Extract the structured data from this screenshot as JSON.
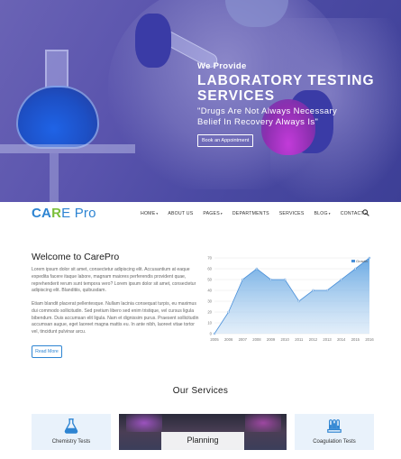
{
  "hero": {
    "subtitle": "We Provide",
    "title_line1": "LABORATORY TESTING",
    "title_line2": "SERVICES",
    "quote_line1": "\"Drugs Are Not Always Necessary",
    "quote_line2": "Belief In Recovery Always Is\"",
    "button_label": "Book an Appointment"
  },
  "nav": {
    "logo_part1": "CA",
    "logo_part2": "R",
    "logo_part3": "E Pro",
    "items": [
      {
        "label": "HOME",
        "has_caret": true
      },
      {
        "label": "ABOUT US",
        "has_caret": false
      },
      {
        "label": "PAGES",
        "has_caret": true
      },
      {
        "label": "DEPARTMENTS",
        "has_caret": false
      },
      {
        "label": "SERVICES",
        "has_caret": false
      },
      {
        "label": "BLOG",
        "has_caret": true
      },
      {
        "label": "CONTACT",
        "has_caret": true
      }
    ],
    "caret": "▾",
    "search_icon": "search-icon"
  },
  "welcome": {
    "title": "Welcome to CarePro",
    "paragraph1": "Lorem ipsum dolor sit amet, consectetur adipiscing elit. Accusantium at eaque expedita facere itaque labore, magnam maiores perferendis provident quae, reprehenderit rerum sunt tempora vero? Lorem ipsum dolor sit amet, consectetur adipiscing elit. Blanditiis, quibusdam.",
    "paragraph2": "Etiam blandit placerat pellentesque. Nullam lacinia consequat turpis, eu maximus dui commodo sollicitudin. Sed pretium libero sed enim tristique, vel cursus ligula bibendum. Duis accumsan elit ligula. Nam et dignissim purus. Praesent sollicitudin accumsan augue, eget laoreet magna mattis eu. In ante nibh, laoreet vitae tortor vel, tincidunt pulvinar arcu.",
    "read_more_label": "Read More"
  },
  "chart_data": {
    "type": "area",
    "x": [
      "2005",
      "2006",
      "2007",
      "2008",
      "2009",
      "2010",
      "2011",
      "2012",
      "2013",
      "2014",
      "2015",
      "2016"
    ],
    "series": [
      {
        "name": "Growth",
        "values": [
          0,
          20,
          50,
          60,
          50,
          50,
          30,
          40,
          40,
          50,
          60,
          70
        ]
      }
    ],
    "ylim": [
      0,
      70
    ],
    "yticks": [
      "0",
      "10",
      "20",
      "30",
      "40",
      "50",
      "60",
      "70"
    ],
    "grid": true,
    "legend": "top-right",
    "color": "#4a90d9"
  },
  "services": {
    "title": "Our Services",
    "cards": [
      {
        "label": "Chemistry Tests",
        "icon": "flask-icon"
      },
      {
        "label": "Planning",
        "icon": ""
      },
      {
        "label": "Coagulation Tests",
        "icon": "test-tubes-icon"
      }
    ]
  },
  "colors": {
    "brand_blue": "#2d84d2",
    "brand_green": "#7bbf3b",
    "hero_overlay": "#5a54ad"
  }
}
